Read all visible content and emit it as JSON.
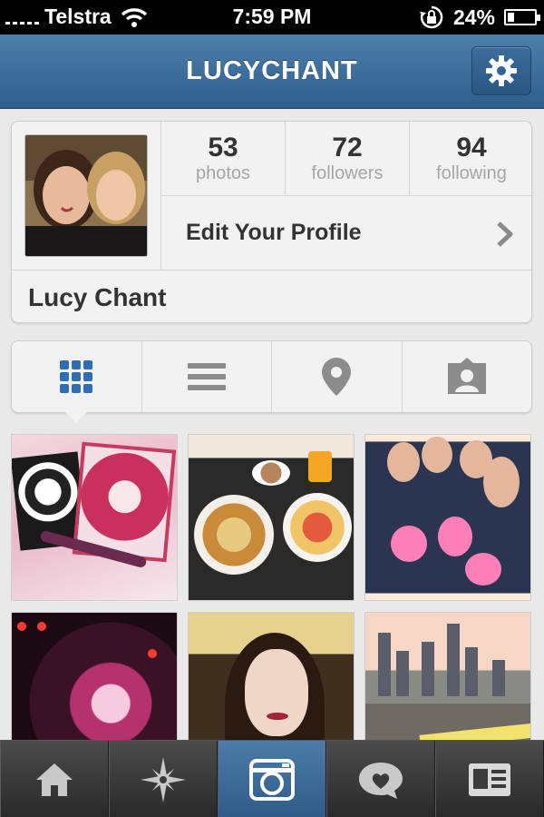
{
  "status_bar": {
    "carrier": "Telstra",
    "time": "7:59 PM",
    "battery": "24%",
    "battery_level": 0.24
  },
  "header": {
    "title": "LUCYCHANT",
    "settings_icon": "gear-icon"
  },
  "profile": {
    "stats": [
      {
        "number": "53",
        "label": "photos"
      },
      {
        "number": "72",
        "label": "followers"
      },
      {
        "number": "94",
        "label": "following"
      }
    ],
    "edit_label": "Edit Your Profile",
    "full_name": "Lucy Chant"
  },
  "view_tabs": [
    "grid-view-icon",
    "list-view-icon",
    "map-pin-icon",
    "tagged-photos-icon"
  ],
  "photos": [
    {
      "subject": "sugar-skull-notebook"
    },
    {
      "subject": "breakfast-plates"
    },
    {
      "subject": "friends-with-drinks"
    },
    {
      "subject": "concert-stage"
    },
    {
      "subject": "selfie"
    },
    {
      "subject": "city-skyline"
    }
  ],
  "tab_bar": {
    "items": [
      "home-icon",
      "explore-icon",
      "camera-icon",
      "news-icon",
      "profile-icon"
    ],
    "active_index": 2
  },
  "colors": {
    "header_blue": "#3d6e9c",
    "stats_grey": "#a6a6a6",
    "accent_blue": "#2f6db5"
  }
}
